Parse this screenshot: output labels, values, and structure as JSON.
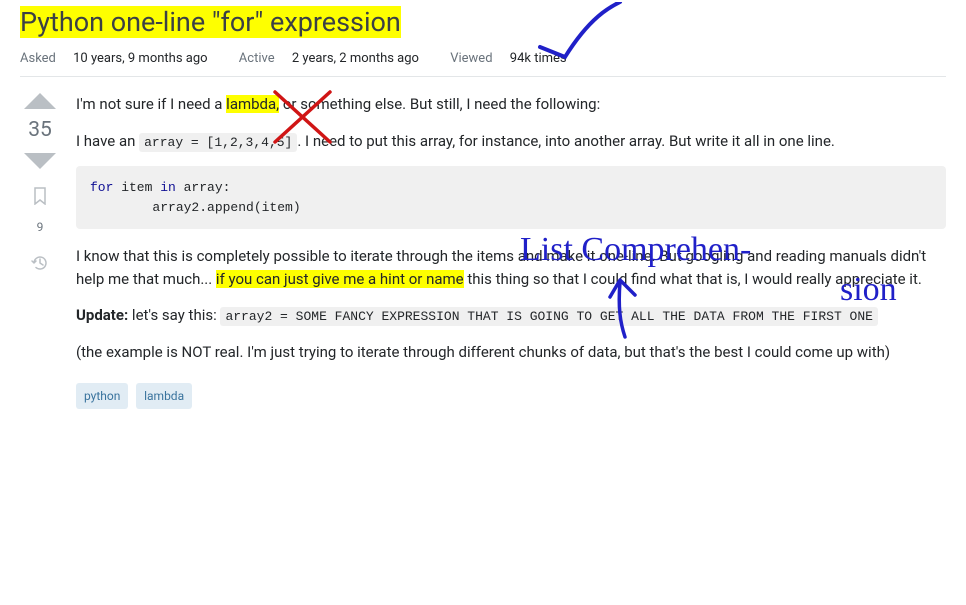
{
  "title": "Python one-line \"for\" expression",
  "meta": {
    "asked_label": "Asked",
    "asked_value": "10 years, 9 months ago",
    "active_label": "Active",
    "active_value": "2 years, 2 months ago",
    "viewed_label": "Viewed",
    "viewed_value": "94k times"
  },
  "votes": {
    "score": "35",
    "bookmark_count": "9"
  },
  "body": {
    "p1_a": "I'm not sure if I need a ",
    "p1_hl": "lambda,",
    "p1_b": " or something else. But still, I need the following:",
    "p2_a": "I have an ",
    "p2_code": "array = [1,2,3,4,5]",
    "p2_b": ". I need to put this array, for instance, into another array. But write it all in one line.",
    "code1_line1_kw1": "for",
    "code1_line1_id1": " item ",
    "code1_line1_kw2": "in",
    "code1_line1_id2": " array:",
    "code1_line2": "        array2.append(item)",
    "p3_a": "I know that this is completely possible to iterate through the items and make it one-line. But googling and reading manuals didn't help me that much... ",
    "p3_hl": "if you can just give me a hint or name",
    "p3_b": " this thing so that I could find what that is, I would really appreciate it.",
    "p4_strong": "Update:",
    "p4_a": " let's say this: ",
    "p4_code": "array2 = SOME FANCY EXPRESSION THAT IS GOING TO GET ALL THE DATA FROM THE FIRST ONE",
    "p5": "(the example is NOT real. I'm just trying to iterate through different chunks of data, but that's the best I could come up with)"
  },
  "tags": [
    "python",
    "lambda"
  ],
  "annotations": {
    "checkmark_color": "#2020c8",
    "x_color": "#d01515",
    "label1": "List Comprehen-",
    "label2": "sion"
  }
}
